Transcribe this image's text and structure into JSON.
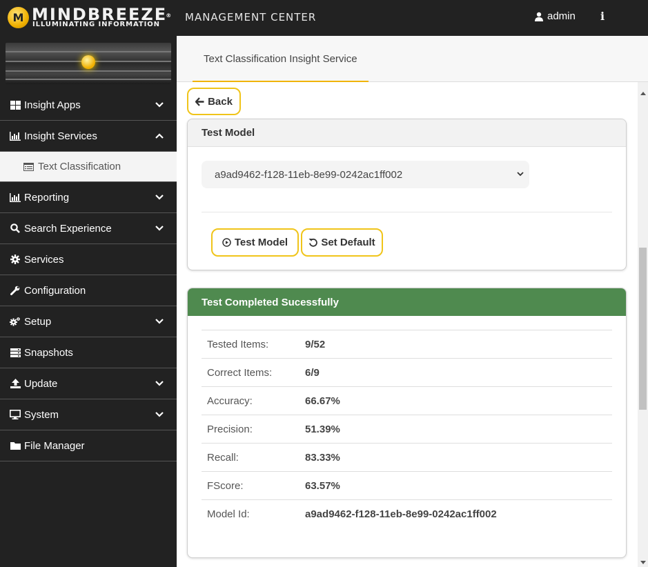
{
  "header": {
    "brand_name": "MINDBREEZE",
    "brand_tagline": "ILLUMINATING INFORMATION",
    "brand_initial": "M",
    "section_title": "MANAGEMENT CENTER",
    "user_name": "admin",
    "info_glyph": "i"
  },
  "sidebar": {
    "items": [
      {
        "label": "Insight Apps",
        "icon": "grid-icon",
        "expanded": false
      },
      {
        "label": "Insight Services",
        "icon": "bar-chart-icon",
        "expanded": true
      },
      {
        "label": "Text Classification",
        "icon": "list-icon",
        "sub": true,
        "selected": true
      },
      {
        "label": "Reporting",
        "icon": "bar-chart-icon",
        "expanded": false
      },
      {
        "label": "Search Experience",
        "icon": "search-icon",
        "expanded": false
      },
      {
        "label": "Services",
        "icon": "gear-icon"
      },
      {
        "label": "Configuration",
        "icon": "wrench-icon"
      },
      {
        "label": "Setup",
        "icon": "gears-icon",
        "expanded": false
      },
      {
        "label": "Snapshots",
        "icon": "stack-icon"
      },
      {
        "label": "Update",
        "icon": "upload-icon",
        "expanded": false
      },
      {
        "label": "System",
        "icon": "monitor-icon",
        "expanded": false
      },
      {
        "label": "File Manager",
        "icon": "folder-icon"
      }
    ]
  },
  "main": {
    "tab_label": "Text Classification Insight Service",
    "back_label": "Back",
    "test_model": {
      "title": "Test Model",
      "selected_model": "a9ad9462-f128-11eb-8e99-0242ac1ff002",
      "test_button": "Test Model",
      "default_button": "Set Default"
    },
    "results": {
      "title": "Test Completed Sucessfully",
      "rows": [
        {
          "label": "Tested Items:",
          "value": "9/52"
        },
        {
          "label": "Correct Items:",
          "value": "6/9"
        },
        {
          "label": "Accuracy:",
          "value": "66.67%"
        },
        {
          "label": "Precision:",
          "value": "51.39%"
        },
        {
          "label": "Recall:",
          "value": "83.33%"
        },
        {
          "label": "FScore:",
          "value": "63.57%"
        },
        {
          "label": "Model Id:",
          "value": "a9ad9462-f128-11eb-8e99-0242ac1ff002"
        }
      ]
    }
  },
  "colors": {
    "topbar": "#222222",
    "accent": "#f0c419",
    "success_header": "#4f8a4f"
  }
}
